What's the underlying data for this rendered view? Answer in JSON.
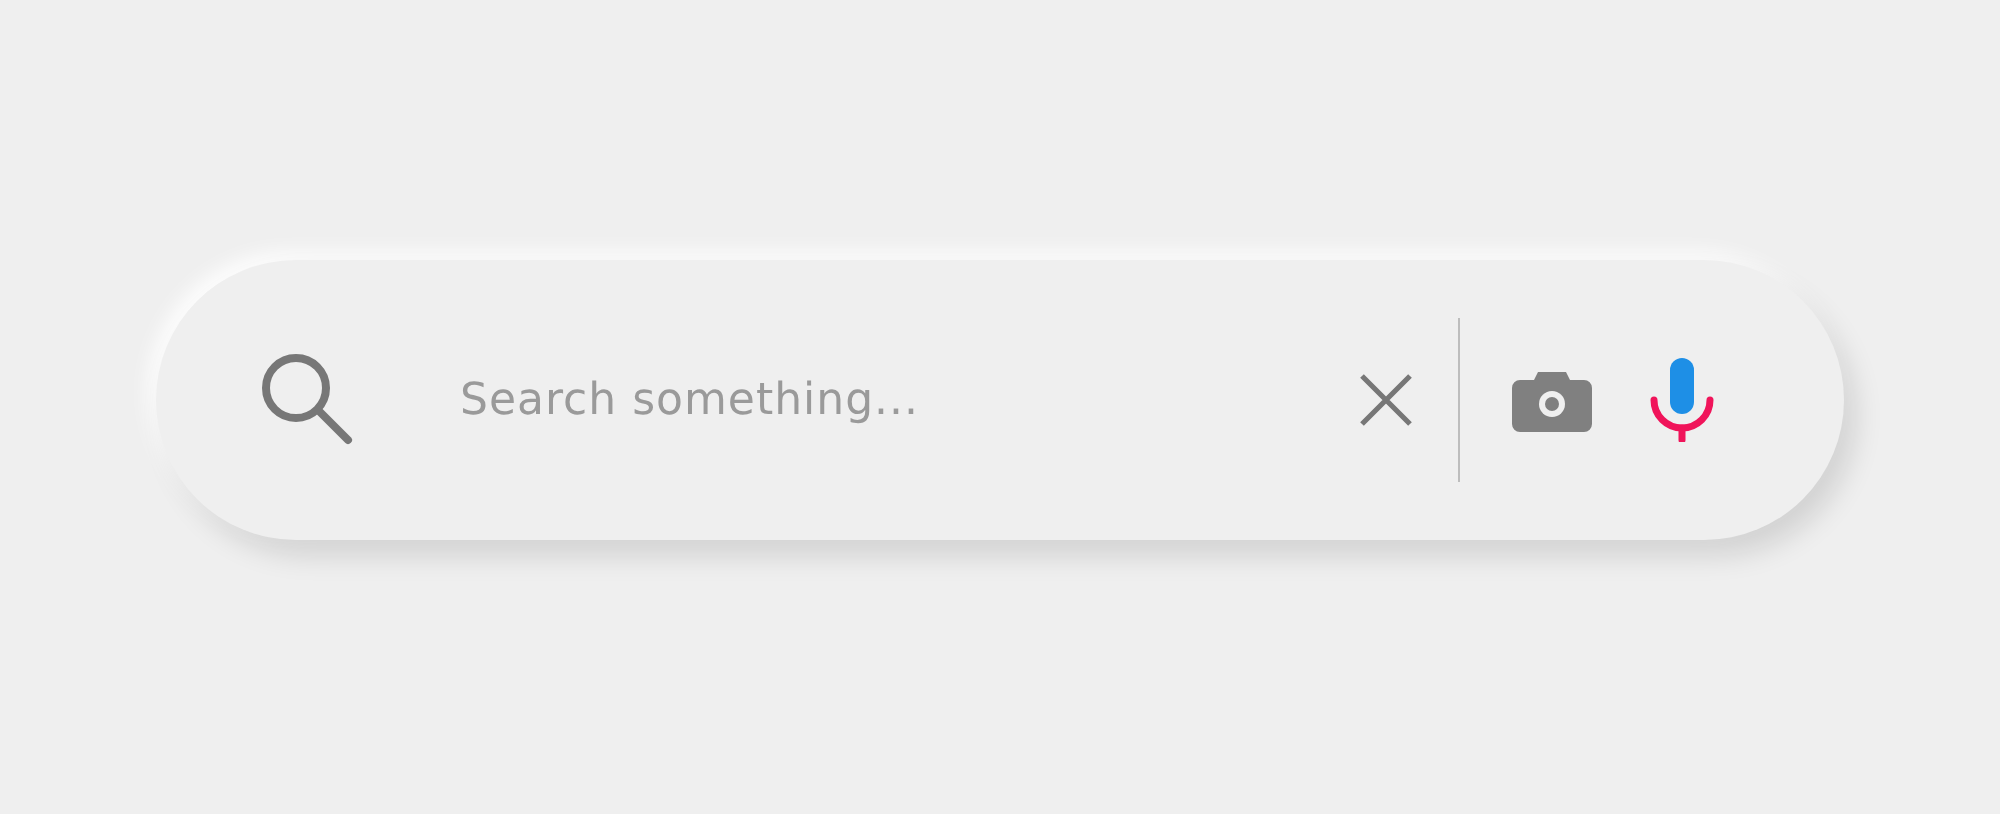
{
  "search": {
    "placeholder": "Search something..."
  }
}
